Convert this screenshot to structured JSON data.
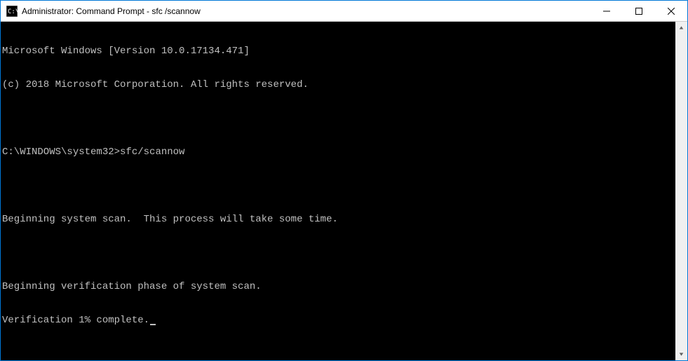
{
  "window": {
    "title": "Administrator: Command Prompt - sfc  /scannow"
  },
  "terminal": {
    "line1": "Microsoft Windows [Version 10.0.17134.471]",
    "line2": "(c) 2018 Microsoft Corporation. All rights reserved.",
    "blank1": "",
    "prompt_path": "C:\\WINDOWS\\system32>",
    "command": "sfc/scannow",
    "blank2": "",
    "line3": "Beginning system scan.  This process will take some time.",
    "blank3": "",
    "line4": "Beginning verification phase of system scan.",
    "line5": "Verification 1% complete."
  }
}
